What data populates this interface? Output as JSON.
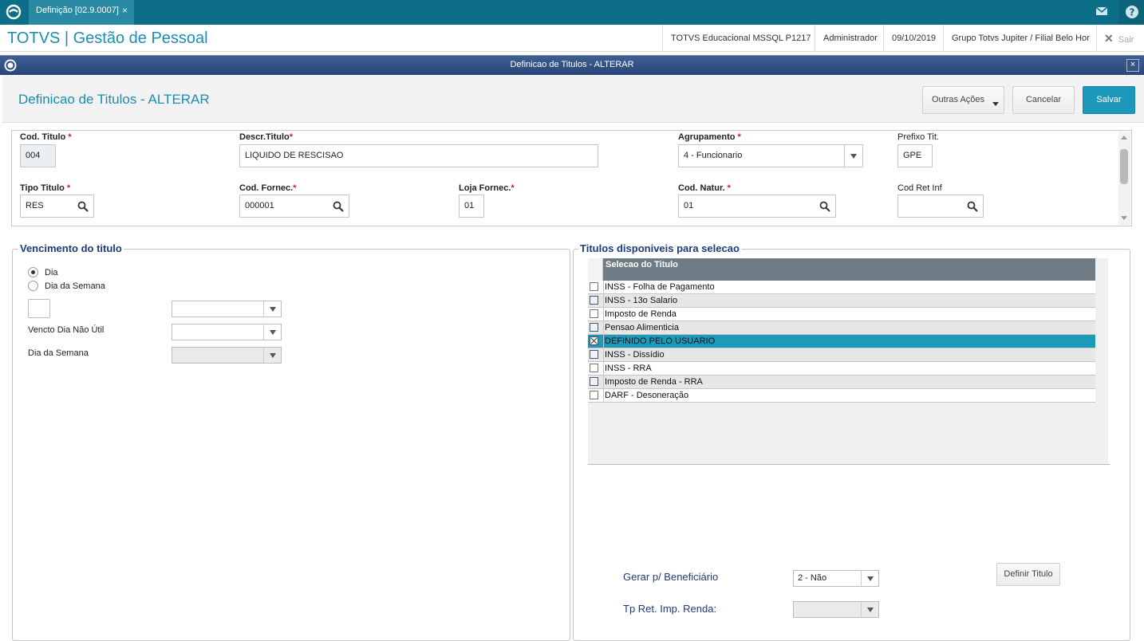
{
  "topbar": {
    "tab_label": "Definição [02.9.0007]",
    "tab_close": "×"
  },
  "header": {
    "brand": "TOTVS | Gestão de Pessoal",
    "db": "TOTVS Educacional MSSQL P1217",
    "user": "Administrador",
    "date": "09/10/2019",
    "branch": "Grupo Totvs Jupiter / Filial Belo Hor",
    "logout": "Sair"
  },
  "dialog": {
    "title": "Definicao de Titulos - ALTERAR",
    "close": "×"
  },
  "page": {
    "title": "Definicao de Titulos - ALTERAR",
    "actions": {
      "more": "Outras Ações",
      "cancel": "Cancelar",
      "save": "Salvar"
    }
  },
  "form": {
    "cod_titulo": {
      "label": "Cod. Titulo",
      "req": "*",
      "value": "004"
    },
    "descr_titulo": {
      "label": "Descr.Titulo",
      "req": "*",
      "value": "LIQUIDO DE RESCISAO"
    },
    "agrupamento": {
      "label": "Agrupamento",
      "req": "*",
      "value": "4 - Funcionario"
    },
    "prefixo": {
      "label": "Prefixo Tit.",
      "value": "GPE"
    },
    "tipo_titulo": {
      "label": "Tipo Titulo",
      "req": "*",
      "value": "RES"
    },
    "cod_fornec": {
      "label": "Cod. Fornec.",
      "req": "*",
      "value": "000001"
    },
    "loja_fornec": {
      "label": "Loja Fornec.",
      "req": "*",
      "value": "01"
    },
    "cod_natur": {
      "label": "Cod. Natur.",
      "req": "*",
      "value": "01"
    },
    "cod_ret_inf": {
      "label": "Cod Ret Inf",
      "value": ""
    }
  },
  "vencimento": {
    "title": "Vencimento do titulo",
    "radio_dia": "Dia",
    "radio_dia_semana": "Dia da Semana",
    "selected": "Dia",
    "vencto_label": "Vencto Dia Não Útil",
    "dia_semana_label": "Dia da Semana"
  },
  "titulos": {
    "title": "Titulos disponiveis para selecao",
    "column": "Selecao do Titulo",
    "rows": [
      {
        "label": "INSS - Folha de Pagamento",
        "checked": false
      },
      {
        "label": "INSS - 13o Salario",
        "checked": false
      },
      {
        "label": "Imposto de Renda",
        "checked": false
      },
      {
        "label": "Pensao Alimenticia",
        "checked": false
      },
      {
        "label": "DEFINIDO PELO USUARIO",
        "checked": true
      },
      {
        "label": "INSS - Dissídio",
        "checked": false
      },
      {
        "label": "INSS - RRA",
        "checked": false
      },
      {
        "label": "Imposto de Renda - RRA",
        "checked": false
      },
      {
        "label": "DARF - Desoneração",
        "checked": false
      }
    ],
    "gerar_label": "Gerar p/ Beneficiário",
    "gerar_value": "2 - Não",
    "tp_ret_label": "Tp Ret. Imp. Renda:",
    "tp_ret_value": "",
    "definir_button": "Definir Titulo"
  },
  "colors": {
    "accent": "#1d98ba",
    "topbar": "#0d6e88",
    "selected_row": "#1e99b7",
    "group_title": "#1d3a7a"
  }
}
